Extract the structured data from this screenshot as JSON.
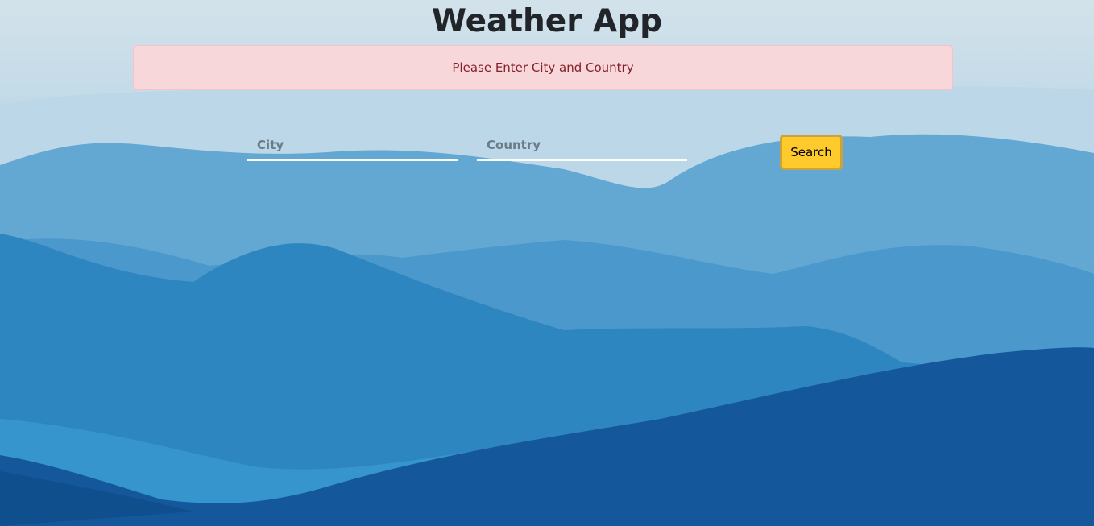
{
  "app": {
    "title": "Weather App"
  },
  "alert": {
    "message": "Please Enter City and Country"
  },
  "form": {
    "city_placeholder": "City",
    "city_value": "",
    "country_placeholder": "Country",
    "country_value": "",
    "search_label": "Search"
  },
  "colors": {
    "alert_bg": "#f8d7da",
    "alert_text": "#842029",
    "button_bg": "#ffca2c",
    "title_text": "#212529"
  }
}
